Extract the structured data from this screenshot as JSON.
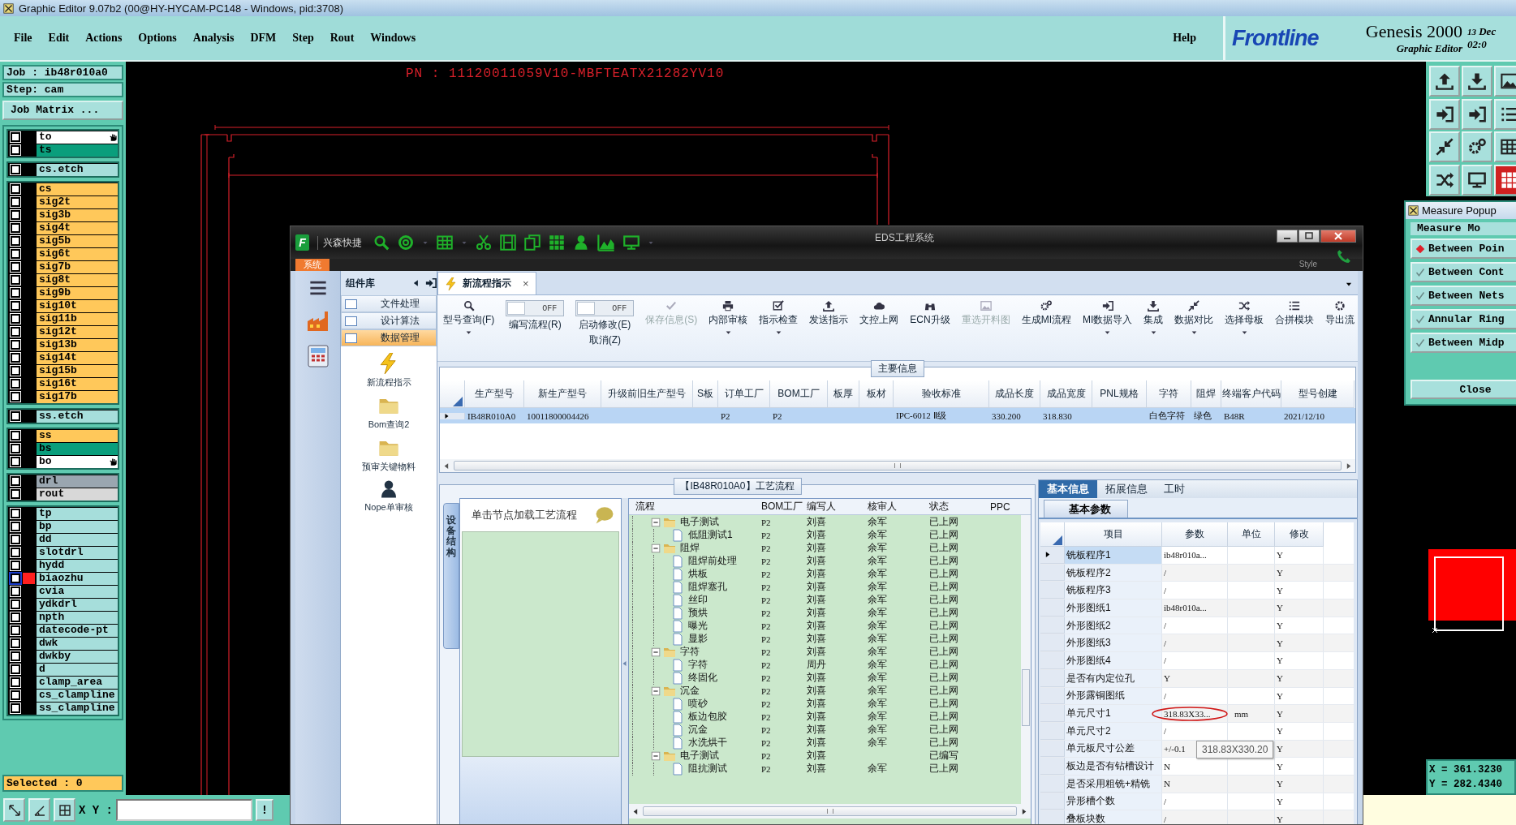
{
  "window": {
    "title": "Graphic Editor 9.07b2 (00@HY-HYCAM-PC148 - Windows, pid:3708)"
  },
  "menu": [
    "File",
    "Edit",
    "Actions",
    "Options",
    "Analysis",
    "DFM",
    "Step",
    "Rout",
    "Windows"
  ],
  "help": "Help",
  "brand": {
    "logo": "Frontline",
    "product": "Genesis 2000",
    "subtitle": "Graphic Editor",
    "day": "13",
    "month": "Dec",
    "time": "02:0"
  },
  "job": "Job : ib48r010a0",
  "step": "Step: cam",
  "job_matrix": "Job Matrix ...",
  "layer_groups": [
    [
      {
        "name": "to",
        "color": "#ffffff",
        "checked": false,
        "pointer": true,
        "affected": false
      },
      {
        "name": "ts",
        "color": "#0a9e7c",
        "checked": false,
        "pointer": false,
        "affected": false
      }
    ],
    [
      {
        "name": "cs.etch",
        "color": "#a6dedb",
        "checked": false,
        "pointer": false,
        "affected": false
      }
    ],
    [
      {
        "name": "cs",
        "color": "#ffc85a",
        "checked": false,
        "pointer": false,
        "affected": false
      },
      {
        "name": "sig2t",
        "color": "#ffc85a",
        "checked": false,
        "pointer": false,
        "affected": false
      },
      {
        "name": "sig3b",
        "color": "#ffc85a",
        "checked": false,
        "pointer": false,
        "affected": false
      },
      {
        "name": "sig4t",
        "color": "#ffc85a",
        "checked": false,
        "pointer": false,
        "affected": false
      },
      {
        "name": "sig5b",
        "color": "#ffc85a",
        "checked": false,
        "pointer": false,
        "affected": false
      },
      {
        "name": "sig6t",
        "color": "#ffc85a",
        "checked": false,
        "pointer": false,
        "affected": false
      },
      {
        "name": "sig7b",
        "color": "#ffc85a",
        "checked": false,
        "pointer": false,
        "affected": false
      },
      {
        "name": "sig8t",
        "color": "#ffc85a",
        "checked": false,
        "pointer": false,
        "affected": false
      },
      {
        "name": "sig9b",
        "color": "#ffc85a",
        "checked": false,
        "pointer": false,
        "affected": false
      },
      {
        "name": "sig10t",
        "color": "#ffc85a",
        "checked": false,
        "pointer": false,
        "affected": false
      },
      {
        "name": "sig11b",
        "color": "#ffc85a",
        "checked": false,
        "pointer": false,
        "affected": false
      },
      {
        "name": "sig12t",
        "color": "#ffc85a",
        "checked": false,
        "pointer": false,
        "affected": false
      },
      {
        "name": "sig13b",
        "color": "#ffc85a",
        "checked": false,
        "pointer": false,
        "affected": false
      },
      {
        "name": "sig14t",
        "color": "#ffc85a",
        "checked": false,
        "pointer": false,
        "affected": false
      },
      {
        "name": "sig15b",
        "color": "#ffc85a",
        "checked": false,
        "pointer": false,
        "affected": false
      },
      {
        "name": "sig16t",
        "color": "#ffc85a",
        "checked": false,
        "pointer": false,
        "affected": false
      },
      {
        "name": "sig17b",
        "color": "#ffc85a",
        "checked": false,
        "pointer": false,
        "affected": false
      }
    ],
    [
      {
        "name": "ss.etch",
        "color": "#a6dedb",
        "checked": false,
        "pointer": false,
        "affected": false
      }
    ],
    [
      {
        "name": "ss",
        "color": "#ffc85a",
        "checked": false,
        "pointer": false,
        "affected": false
      },
      {
        "name": "bs",
        "color": "#0a9e7c",
        "checked": false,
        "pointer": false,
        "affected": false
      },
      {
        "name": "bo",
        "color": "#ffffff",
        "checked": false,
        "pointer": true,
        "affected": false
      }
    ],
    [
      {
        "name": "drl",
        "color": "#9aa6b0",
        "checked": false,
        "pointer": false,
        "affected": false
      },
      {
        "name": "rout",
        "color": "#d8d8d8",
        "checked": false,
        "pointer": false,
        "affected": false
      }
    ],
    [
      {
        "name": "tp",
        "color": "#a6dedb",
        "checked": false,
        "pointer": false,
        "affected": false
      },
      {
        "name": "bp",
        "color": "#a6dedb",
        "checked": false,
        "pointer": false,
        "affected": false
      },
      {
        "name": "dd",
        "color": "#a6dedb",
        "checked": false,
        "pointer": false,
        "affected": false
      },
      {
        "name": "slotdrl",
        "color": "#a6dedb",
        "checked": false,
        "pointer": false,
        "affected": false
      },
      {
        "name": "hydd",
        "color": "#a6dedb",
        "checked": false,
        "pointer": false,
        "affected": false
      },
      {
        "name": "biaozhu",
        "color": "#a6dedb",
        "checked": false,
        "pointer": false,
        "affected": true
      },
      {
        "name": "cvia",
        "color": "#a6dedb",
        "checked": false,
        "pointer": false,
        "affected": false
      },
      {
        "name": "ydkdrl",
        "color": "#a6dedb",
        "checked": false,
        "pointer": false,
        "affected": false
      },
      {
        "name": "npth",
        "color": "#a6dedb",
        "checked": false,
        "pointer": false,
        "affected": false
      },
      {
        "name": "datecode-pt",
        "color": "#a6dedb",
        "checked": false,
        "pointer": false,
        "affected": false
      },
      {
        "name": "dwk",
        "color": "#a6dedb",
        "checked": false,
        "pointer": false,
        "affected": false
      },
      {
        "name": "dwkby",
        "color": "#a6dedb",
        "checked": false,
        "pointer": false,
        "affected": false
      },
      {
        "name": "d",
        "color": "#a6dedb",
        "checked": false,
        "pointer": false,
        "affected": false
      },
      {
        "name": "clamp_area",
        "color": "#a6dedb",
        "checked": false,
        "pointer": false,
        "affected": false
      },
      {
        "name": "cs_clampline",
        "color": "#a6dedb",
        "checked": false,
        "pointer": false,
        "affected": false
      },
      {
        "name": "ss_clampline",
        "color": "#a6dedb",
        "checked": false,
        "pointer": false,
        "affected": false
      }
    ]
  ],
  "selected_count": "Selected : 0",
  "xy_label": "X Y :",
  "bang": "!",
  "pn": "PN : 11120011059V10-MBFTEATX21282YV10",
  "readout": {
    "x": "X = 361.3230",
    "y": "Y = 282.4340"
  },
  "measure_popup": {
    "title": "Measure Popup",
    "mode": "Measure Mo",
    "options": [
      {
        "label": "Between Poin",
        "selected": true
      },
      {
        "label": "Between Cont",
        "selected": false
      },
      {
        "label": "Between Nets",
        "selected": false
      },
      {
        "label": "Annular Ring",
        "selected": false
      },
      {
        "label": "Between Midp",
        "selected": false
      }
    ],
    "close": "Close"
  },
  "eds": {
    "logo": "F",
    "brand": "兴森快捷",
    "title": "EDS工程系统",
    "system_tab": "系统",
    "style": "Style",
    "sidebar": {
      "title": "组件库",
      "items": [
        {
          "label": "文件处理",
          "selected": false
        },
        {
          "label": "设计算法",
          "selected": false
        },
        {
          "label": "数据管理",
          "selected": true
        }
      ],
      "tools": [
        "新流程指示",
        "Bom查询2",
        "预审关键物料",
        "Nope单审核"
      ]
    },
    "doc_tab": {
      "label": "新流程指示",
      "close": "×"
    },
    "toolbar": [
      {
        "kind": "button",
        "label": "型号查询(F)",
        "dropdown": true,
        "disabled": false
      },
      {
        "kind": "toggle",
        "label": "编写流程(R)",
        "state": "OFF",
        "on": false
      },
      {
        "kind": "toggle",
        "label": "启动修改(E)",
        "sublabel": "取消(Z)",
        "state": "OFF",
        "on": false
      },
      {
        "kind": "button",
        "label": "保存信息(S)",
        "dropdown": false,
        "disabled": true
      },
      {
        "kind": "button",
        "label": "内部审核",
        "dropdown": true,
        "disabled": false
      },
      {
        "kind": "button",
        "label": "指示检查",
        "dropdown": true,
        "disabled": false
      },
      {
        "kind": "button",
        "label": "发送指示",
        "dropdown": false,
        "disabled": false
      },
      {
        "kind": "button",
        "label": "文控上网",
        "dropdown": false,
        "disabled": false
      },
      {
        "kind": "button",
        "label": "ECN升级",
        "dropdown": false,
        "disabled": false
      },
      {
        "kind": "button",
        "label": "重选开料图",
        "dropdown": false,
        "disabled": true
      },
      {
        "kind": "button",
        "label": "生成MI流程",
        "dropdown": false,
        "disabled": false
      },
      {
        "kind": "button",
        "label": "MI数据导入",
        "dropdown": true,
        "disabled": false
      },
      {
        "kind": "button",
        "label": "集成",
        "dropdown": true,
        "disabled": false
      },
      {
        "kind": "button",
        "label": "数据对比",
        "dropdown": true,
        "disabled": false
      },
      {
        "kind": "button",
        "label": "选择母板",
        "dropdown": true,
        "disabled": false
      },
      {
        "kind": "button",
        "label": "合拼模块",
        "dropdown": false,
        "disabled": false
      },
      {
        "kind": "button",
        "label": "导出流",
        "dropdown": false,
        "disabled": false
      }
    ],
    "main_info": {
      "title": "主要信息",
      "columns": [
        "生产型号",
        "新生产型号",
        "升级前旧生产型号",
        "S板",
        "订单工厂",
        "BOM工厂",
        "板厚",
        "板材",
        "验收标准",
        "成品长度",
        "成品宽度",
        "PNL规格",
        "字符",
        "阻焊",
        "终端客户代码",
        "型号创建"
      ],
      "rows": [
        {
          "selected": true,
          "cells": [
            "IB48R010A0",
            "10011800004426",
            null,
            null,
            "P2",
            "P2",
            null,
            null,
            "IPC-6012 Ⅱ级",
            "330.200",
            "318.830",
            null,
            "白色字符",
            "绿色",
            "B48R",
            "2021/12/10"
          ]
        }
      ]
    },
    "process": {
      "title": "【IB48R010A0】工艺流程",
      "side_tab": "设备结构",
      "hint": "单击节点加载工艺流程",
      "columns": [
        "流程",
        "BOM工厂",
        "编写人",
        "核审人",
        "状态",
        "PPC"
      ],
      "tree": [
        {
          "kind": "folder",
          "label": "电子测试",
          "expanded": true,
          "bom": "P2",
          "writer": "刘喜",
          "reviewer": "余军",
          "status": "已上网",
          "children": [
            {
              "kind": "file",
              "label": "低阻测试1",
              "bom": "P2",
              "writer": "刘喜",
              "reviewer": "余军",
              "status": "已上网"
            }
          ]
        },
        {
          "kind": "folder",
          "label": "阻焊",
          "expanded": true,
          "bom": "P2",
          "writer": "刘喜",
          "reviewer": "余军",
          "status": "已上网",
          "children": [
            {
              "kind": "file",
              "label": "阻焊前处理",
              "bom": "P2",
              "writer": "刘喜",
              "reviewer": "余军",
              "status": "已上网"
            },
            {
              "kind": "file",
              "label": "烘板",
              "bom": "P2",
              "writer": "刘喜",
              "reviewer": "余军",
              "status": "已上网"
            },
            {
              "kind": "file",
              "label": "阻焊塞孔",
              "bom": "P2",
              "writer": "刘喜",
              "reviewer": "余军",
              "status": "已上网"
            },
            {
              "kind": "file",
              "label": "丝印",
              "bom": "P2",
              "writer": "刘喜",
              "reviewer": "余军",
              "status": "已上网"
            },
            {
              "kind": "file",
              "label": "预烘",
              "bom": "P2",
              "writer": "刘喜",
              "reviewer": "余军",
              "status": "已上网"
            },
            {
              "kind": "file",
              "label": "曝光",
              "bom": "P2",
              "writer": "刘喜",
              "reviewer": "余军",
              "status": "已上网"
            },
            {
              "kind": "file",
              "label": "显影",
              "bom": "P2",
              "writer": "刘喜",
              "reviewer": "余军",
              "status": "已上网"
            }
          ]
        },
        {
          "kind": "folder",
          "label": "字符",
          "expanded": true,
          "bom": "P2",
          "writer": "刘喜",
          "reviewer": "余军",
          "status": "已上网",
          "children": [
            {
              "kind": "file",
              "label": "字符",
              "bom": "P2",
              "writer": "周丹",
              "reviewer": "余军",
              "status": "已上网"
            },
            {
              "kind": "file",
              "label": "终固化",
              "bom": "P2",
              "writer": "刘喜",
              "reviewer": "余军",
              "status": "已上网"
            }
          ]
        },
        {
          "kind": "folder",
          "label": "沉金",
          "expanded": true,
          "bom": "P2",
          "writer": "刘喜",
          "reviewer": "余军",
          "status": "已上网",
          "children": [
            {
              "kind": "file",
              "label": "喷砂",
              "bom": "P2",
              "writer": "刘喜",
              "reviewer": "余军",
              "status": "已上网"
            },
            {
              "kind": "file",
              "label": "板边包胶",
              "bom": "P2",
              "writer": "刘喜",
              "reviewer": "余军",
              "status": "已上网"
            },
            {
              "kind": "file",
              "label": "沉金",
              "bom": "P2",
              "writer": "刘喜",
              "reviewer": "余军",
              "status": "已上网"
            },
            {
              "kind": "file",
              "label": "水洗烘干",
              "bom": "P2",
              "writer": "刘喜",
              "reviewer": "余军",
              "status": "已上网"
            }
          ]
        },
        {
          "kind": "folder",
          "label": "电子测试",
          "expanded": true,
          "bom": "P2",
          "writer": "刘喜",
          "status": "已编写",
          "children": [
            {
              "kind": "file",
              "label": "阻抗测试",
              "bom": "P2",
              "writer": "刘喜",
              "reviewer": "余军",
              "status": "已上网"
            }
          ]
        }
      ]
    },
    "details": {
      "tabs": [
        {
          "label": "基本信息",
          "selected": true
        },
        {
          "label": "拓展信息",
          "selected": false
        },
        {
          "label": "工时",
          "selected": false
        }
      ],
      "subtab": "基本参数",
      "columns": [
        "项目",
        "参数",
        "单位",
        "修改"
      ],
      "rows": [
        {
          "item": "铣板程序1",
          "param": "ib48r010a...",
          "modify": "Y",
          "selected": true
        },
        {
          "item": "铣板程序2",
          "param": "/",
          "modify": "Y",
          "selected": false
        },
        {
          "item": "铣板程序3",
          "param": "/",
          "modify": "Y",
          "selected": false
        },
        {
          "item": "外形图纸1",
          "param": "ib48r010a...",
          "modify": "Y",
          "selected": false
        },
        {
          "item": "外形图纸2",
          "param": "/",
          "modify": "Y",
          "selected": false
        },
        {
          "item": "外形图纸3",
          "param": "/",
          "modify": "Y",
          "selected": false
        },
        {
          "item": "外形图纸4",
          "param": "/",
          "modify": "Y",
          "selected": false
        },
        {
          "item": "是否有内定位孔",
          "param": "Y",
          "modify": "Y",
          "selected": false
        },
        {
          "item": "外形露铜图纸",
          "param": "/",
          "modify": "Y",
          "selected": false
        },
        {
          "item": "单元尺寸1",
          "param": "318.83X33...",
          "unit": "mm",
          "modify": "Y",
          "selected": false,
          "circled": true
        },
        {
          "item": "单元尺寸2",
          "param": "/",
          "modify": "Y",
          "selected": false
        },
        {
          "item": "单元板尺寸公差",
          "param": "+/-0.1",
          "modify": "Y",
          "selected": false
        },
        {
          "item": "板边是否有钻槽设计",
          "param": "N",
          "modify": "Y",
          "selected": false
        },
        {
          "item": "是否采用粗铣+精铣",
          "param": "N",
          "modify": "Y",
          "selected": false
        },
        {
          "item": "异形槽个数",
          "param": "/",
          "modify": "Y",
          "selected": false
        },
        {
          "item": "叠板块数",
          "param": "/",
          "modify": "Y",
          "selected": false
        }
      ],
      "tooltip": "318.83X330.20"
    }
  }
}
